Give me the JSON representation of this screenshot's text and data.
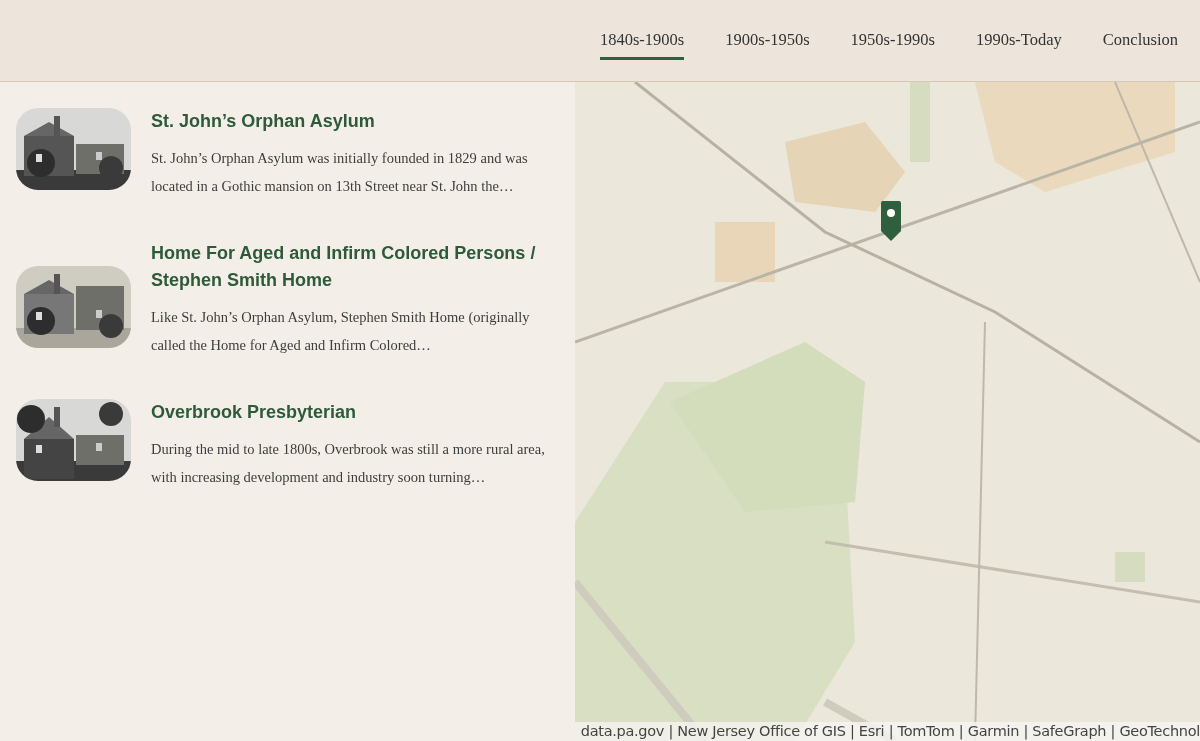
{
  "tabs": [
    {
      "label": "1840s-1900s",
      "selected": true
    },
    {
      "label": "1900s-1950s",
      "selected": false
    },
    {
      "label": "1950s-1990s",
      "selected": false
    },
    {
      "label": "1990s-Today",
      "selected": false
    },
    {
      "label": "Conclusion",
      "selected": false
    }
  ],
  "stories": [
    {
      "title": "St. John’s Orphan Asylum",
      "summary": "St. John’s Orphan Asylum was initially founded in 1829 and was located in a Gothic mansion on 13th Street near St. John the…"
    },
    {
      "title": "Home For Aged and Infirm Colored Persons / Stephen Smith Home",
      "summary": "Like St. John’s Orphan Asylum, Stephen Smith Home (originally called the Home for Aged and Infirm Colored…"
    },
    {
      "title": "Overbrook Presbyterian",
      "summary": "During the mid to late 1800s, Overbrook was still a more rural area, with increasing development and industry soon turning…"
    }
  ],
  "map": {
    "kind": "picture",
    "attribution": "data.pa.gov | New Jersey Office of GIS | Esri | TomTom | Garmin | SafeGraph | GeoTechnol"
  }
}
